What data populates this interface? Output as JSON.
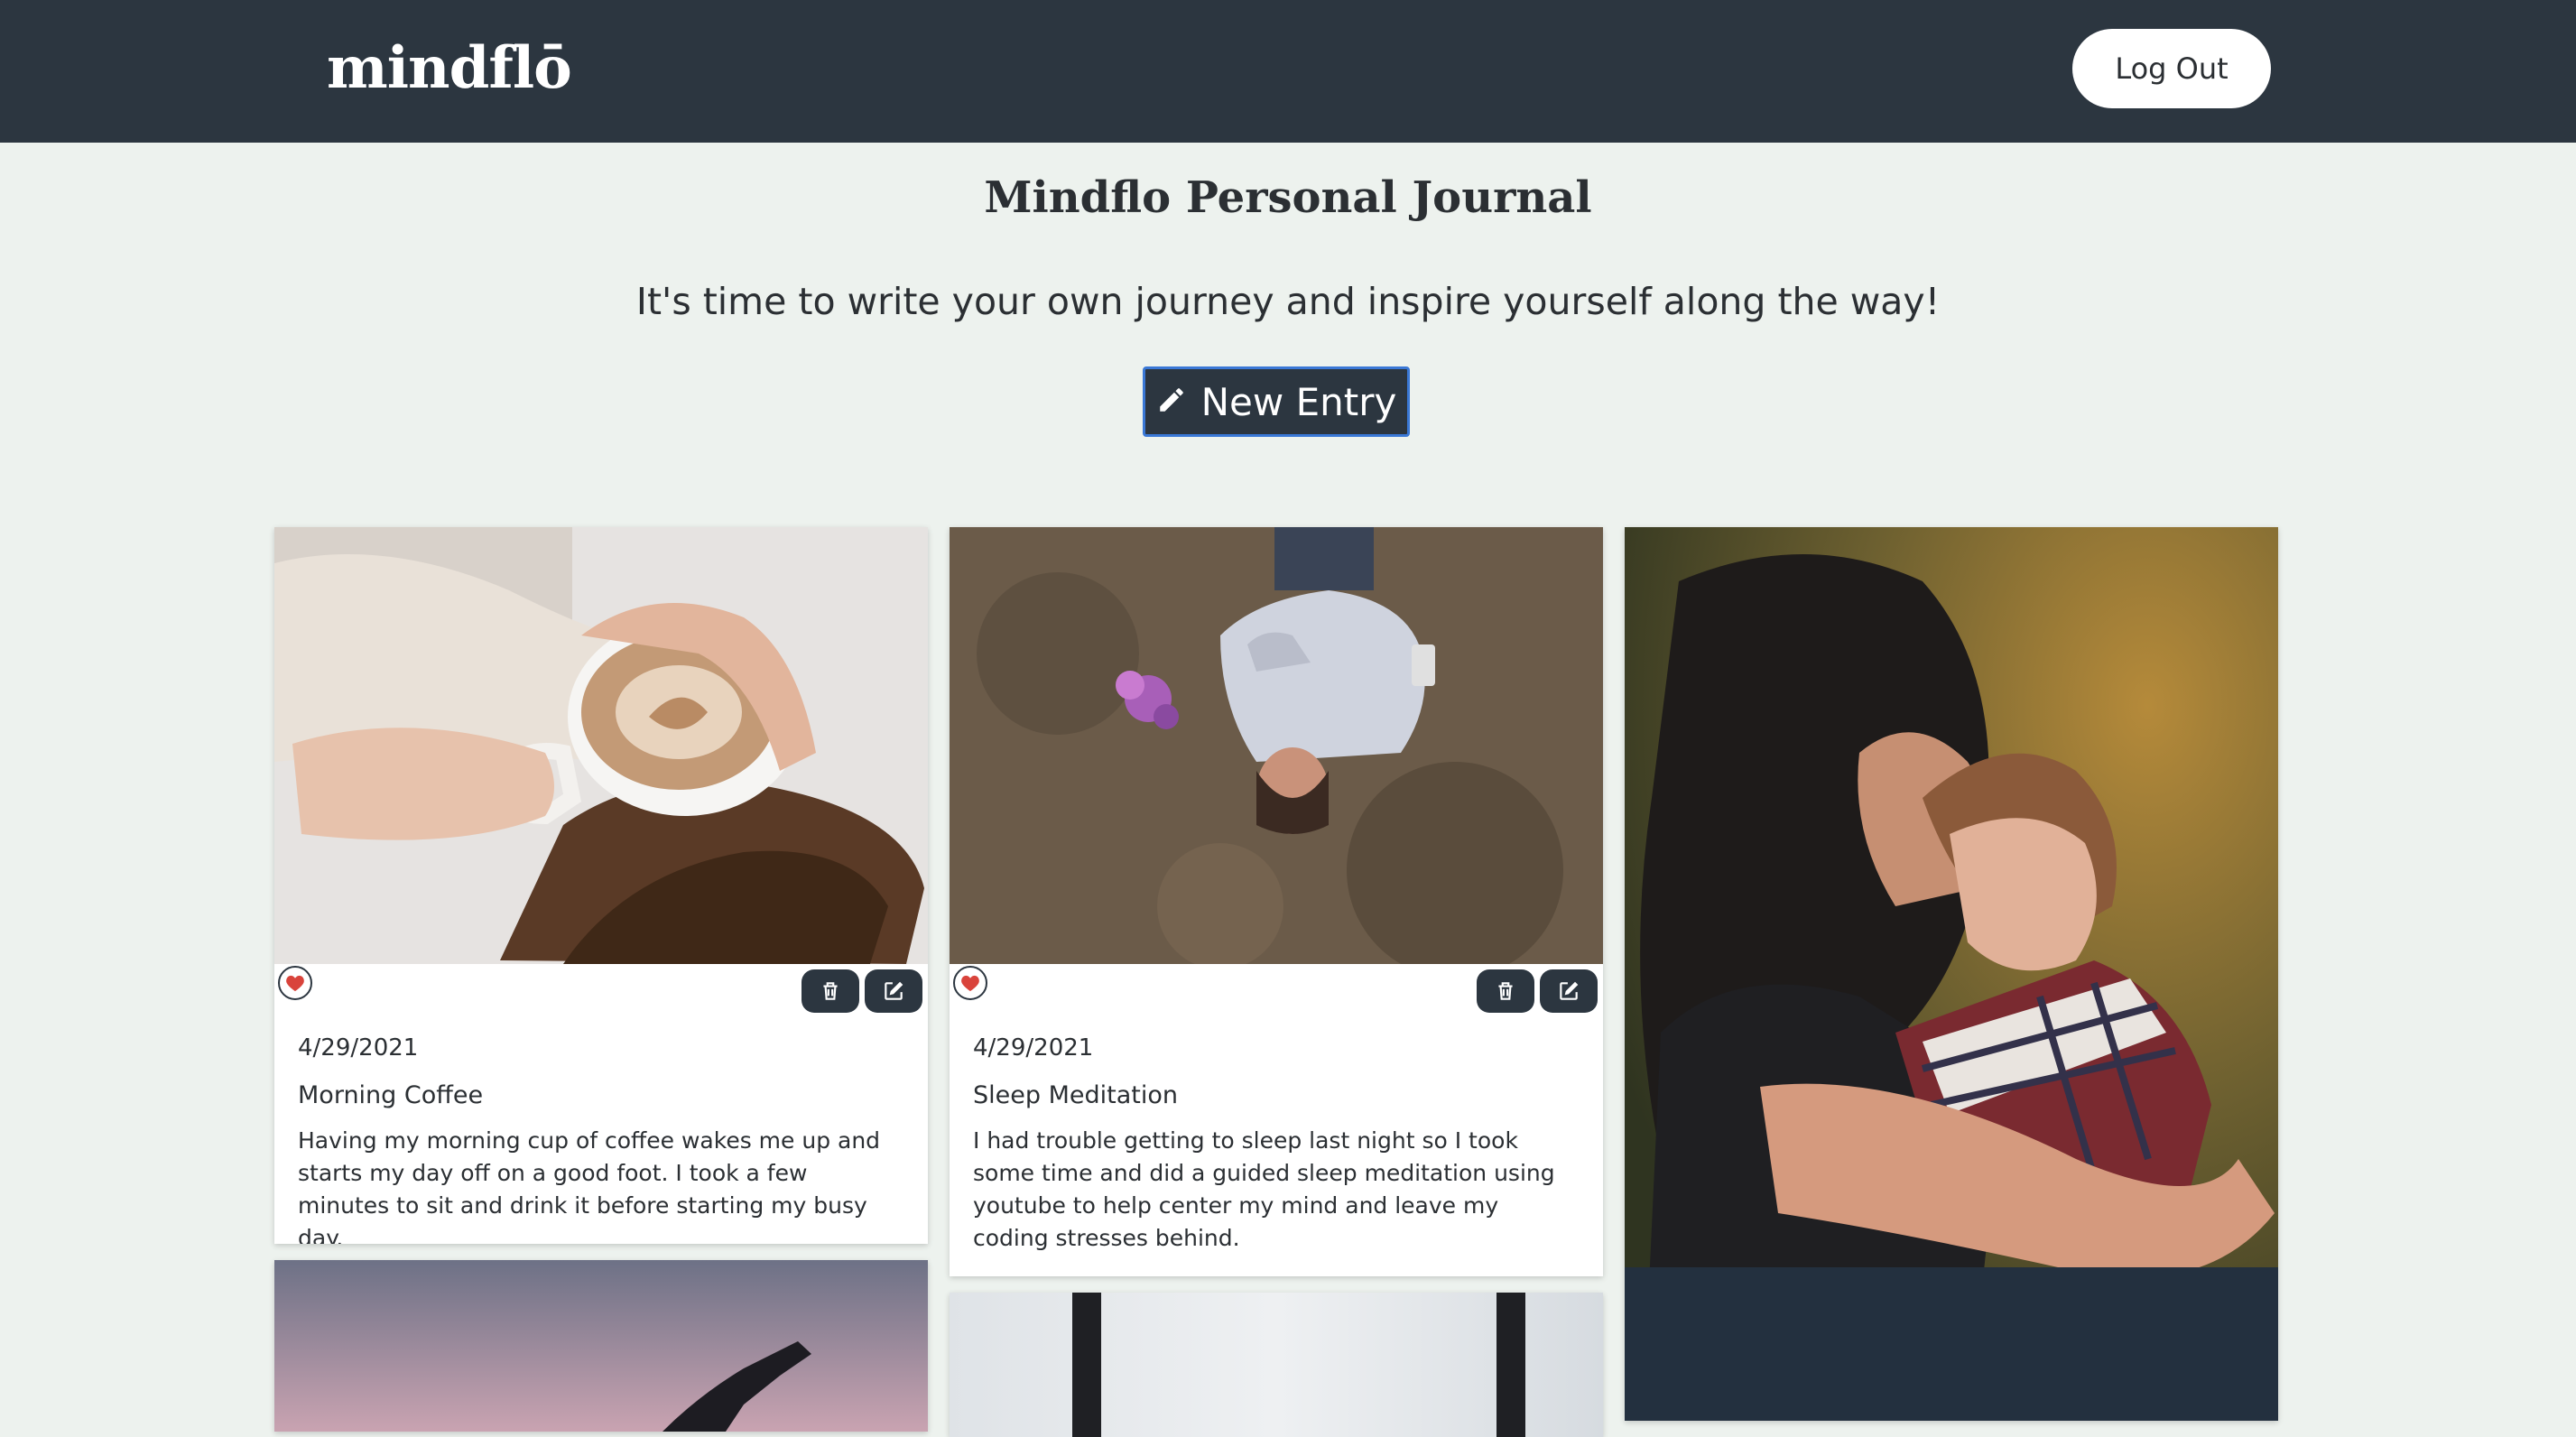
{
  "header": {
    "logo": "mindflō",
    "logout_label": "Log Out"
  },
  "main": {
    "title": "Mindflo Personal Journal",
    "subtitle": "It's time to write your own journey and inspire yourself along the way!",
    "new_entry_label": "New Entry"
  },
  "entries": [
    {
      "date": "4/29/2021",
      "title": "Morning Coffee",
      "body": "Having my morning cup of coffee wakes me up and starts my day off on a good foot. I took a few minutes to sit and drink it before starting my busy day."
    },
    {
      "date": "4/29/2021",
      "title": "Sleep Meditation",
      "body": "I had trouble getting to sleep last night so I took some time and did a guided sleep meditation using youtube to help center my mind and leave my coding stresses behind."
    }
  ],
  "colors": {
    "header_bg": "#2c3640",
    "page_bg": "#edf2ee",
    "heart": "#d9433b",
    "button_border": "#3a78d6"
  },
  "icons": [
    "pencil-icon",
    "heart-icon",
    "trash-icon",
    "edit-icon"
  ]
}
